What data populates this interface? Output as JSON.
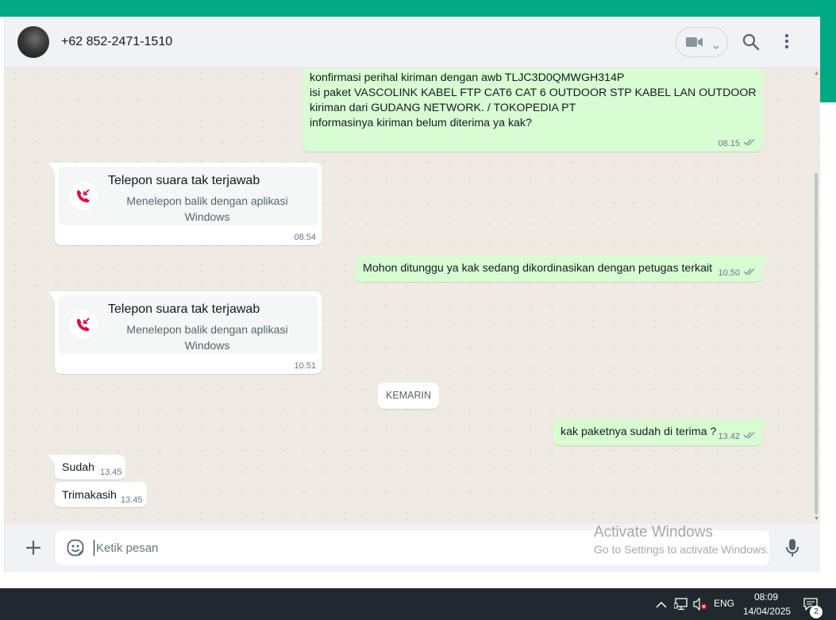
{
  "header": {
    "contact_name": "+62 852-2471-1510",
    "video_icon": "video-camera-icon",
    "search_icon": "search-icon",
    "menu_icon": "more-vertical-icon"
  },
  "messages": {
    "long": {
      "lines": [
        "konfirmasi perihal kiriman dengan awb TLJC3D0QMWGH314P",
        "isi paket VASCOLINK KABEL FTP CAT6 CAT 6 OUTDOOR STP KABEL LAN OUTDOOR",
        "kiriman dari GUDANG NETWORK. / TOKOPEDIA PT",
        "",
        "informasinya kiriman belum diterima ya kak?"
      ],
      "time": "08.15"
    },
    "call1": {
      "title": "Telepon suara tak terjawab",
      "subtitle": "Menelepon balik dengan aplikasi Windows",
      "time": "08.54"
    },
    "wait": {
      "text": "Mohon ditunggu ya kak sedang dikordinasikan dengan petugas terkait",
      "time": "10.50"
    },
    "call2": {
      "title": "Telepon suara tak terjawab",
      "subtitle": "Menelepon balik dengan aplikasi Windows",
      "time": "10.51"
    },
    "date_divider": "KEMARIN",
    "question": {
      "text": "kak paketnya sudah di terima ?",
      "time": "13.42"
    },
    "sudah": {
      "text": "Sudah",
      "time": "13.45"
    },
    "trimakasih": {
      "text": "Trimakasih",
      "time": "13.45"
    }
  },
  "composer": {
    "placeholder": "Ketik pesan",
    "plus_icon": "plus-icon",
    "emoji_icon": "emoji-icon",
    "mic_icon": "microphone-icon"
  },
  "watermark": {
    "title": "Activate Windows",
    "subtitle": "Go to Settings to activate Windows."
  },
  "taskbar": {
    "language": "ENG",
    "time": "08:09",
    "date": "14/04/2025",
    "notification_count": "2"
  },
  "colors": {
    "accent": "#00a884",
    "outgoing_bubble": "#d9fdd3",
    "incoming_bubble": "#ffffff",
    "missed_call_red": "#ea0038",
    "read_ticks": "#8696a0"
  }
}
